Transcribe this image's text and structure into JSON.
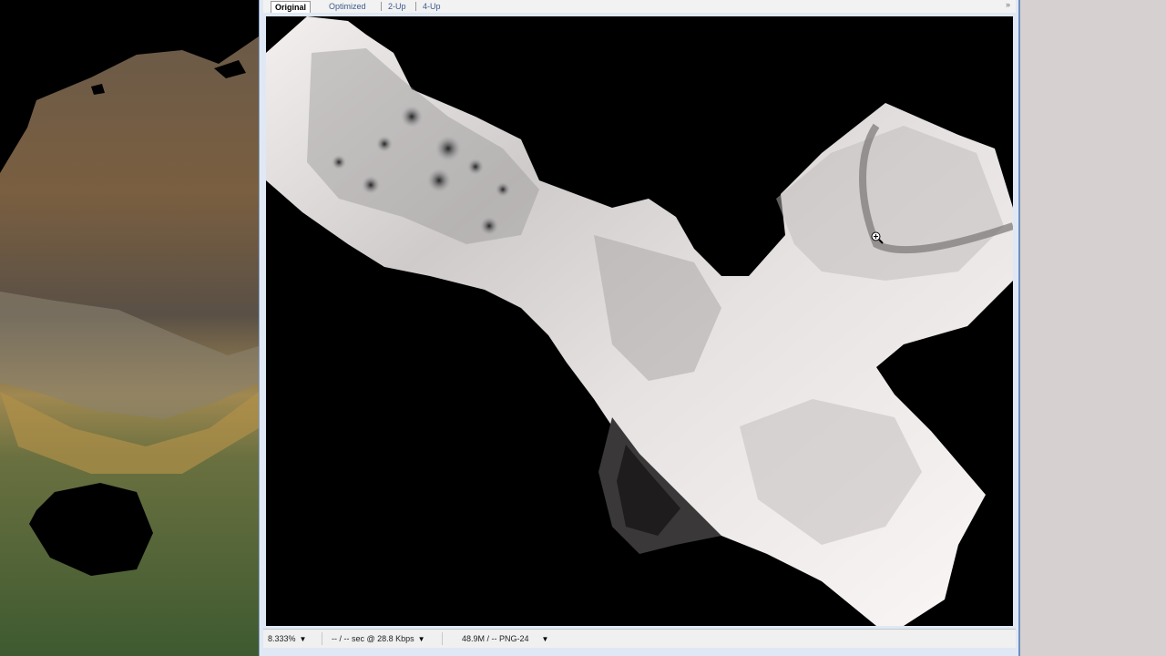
{
  "tabs": [
    {
      "label": "Original",
      "active": true
    },
    {
      "label": "Optimized",
      "active": false
    },
    {
      "label": "2-Up",
      "active": false
    },
    {
      "label": "4-Up",
      "active": false
    }
  ],
  "expand_icon": "double-chevron-right-icon",
  "status": {
    "zoom": "8.333%",
    "speed": "-- / -- sec @ 28.8 Kbps",
    "file_info": "48.9M / -- PNG-24"
  },
  "colors": {
    "window_frame": "#dfe8f4",
    "tab_text": "#3b5b8c",
    "right_panel": "#d6d0d0",
    "canvas_bg": "#000000"
  }
}
